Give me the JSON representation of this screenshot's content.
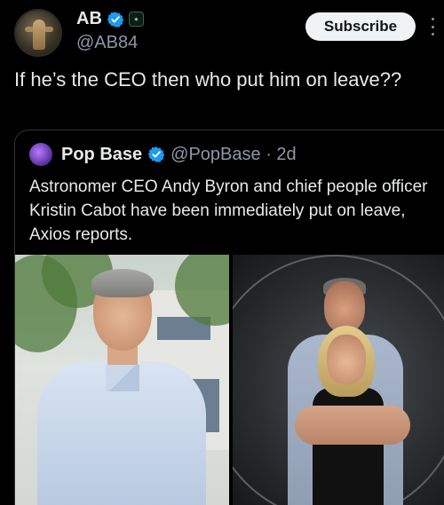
{
  "post": {
    "author_name": "AB",
    "author_handle": "@AB84",
    "subscribe_label": "Subscribe",
    "text": "If he’s the CEO then who put him on leave??"
  },
  "quoted_post": {
    "author_name": "Pop Base",
    "author_handle": "@PopBase · 2d",
    "text": "Astronomer CEO Andy Byron and chief people officer Kristin Cabot have been immediately put on leave, Axios reports."
  },
  "colors": {
    "background": "#000000",
    "verified_blue": "#1d9bf0",
    "text_primary": "#e7e9ea",
    "text_secondary": "#8b98a5"
  },
  "icons": {
    "verified": "verified-check-icon",
    "more": "more-options-icon"
  }
}
